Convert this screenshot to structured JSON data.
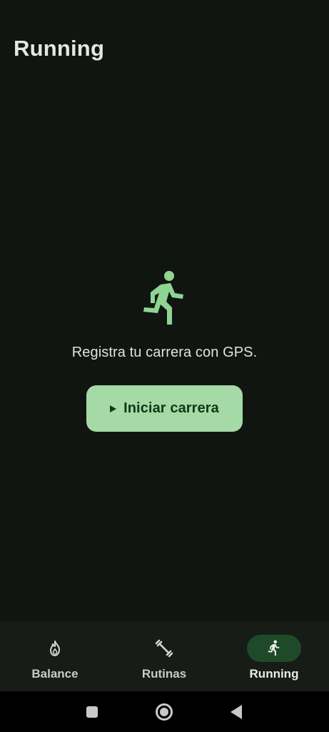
{
  "app": {
    "title": "Running"
  },
  "empty_state": {
    "icon": "running-figure-icon",
    "message": "Registra tu carrera con GPS."
  },
  "primary_action": {
    "icon": "play-icon",
    "label": "Iniciar carrera"
  },
  "bottom_nav": {
    "selected": "Running",
    "items": [
      {
        "label": "Balance",
        "icon": "flame-icon"
      },
      {
        "label": "Rutinas",
        "icon": "dumbbell-icon"
      },
      {
        "label": "Running",
        "icon": "running-icon"
      }
    ]
  },
  "system_nav": {
    "buttons": [
      "recents-icon",
      "home-icon",
      "back-icon"
    ]
  },
  "colors": {
    "background": "#111512",
    "accent": "#a5d9a6",
    "accent_text": "#0b3a14",
    "nav_active_pill": "#1f4a2a",
    "runner_icon": "#8fd492"
  }
}
